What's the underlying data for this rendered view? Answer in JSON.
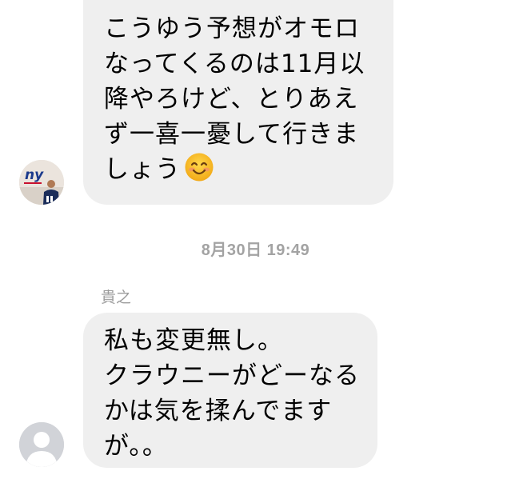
{
  "thread": {
    "messages": [
      {
        "direction": "incoming",
        "lines": [
          "こうゆう予想がオモロ",
          "なってくるのは11月以",
          "降やろけど、とりあえ",
          "ず一喜一憂して行きま",
          "しょう"
        ],
        "trailing_emoji": "smiling-face-icon"
      },
      {
        "direction": "incoming",
        "sender": "貴之",
        "lines": [
          "私も変更無し。",
          "クラウニーがどーなる",
          "かは気を揉んでます",
          "が。。"
        ]
      }
    ],
    "timestamp": "8月30日 19:49"
  },
  "colors": {
    "bubble_background": "#efefef",
    "timestamp_text": "#a3a3a3",
    "sender_text": "#9c9c9c",
    "emoji_face": "#f7c02c"
  },
  "icons": {
    "avatar_1": "sender-photo-avatar-icon",
    "avatar_2": "default-person-avatar-icon"
  }
}
